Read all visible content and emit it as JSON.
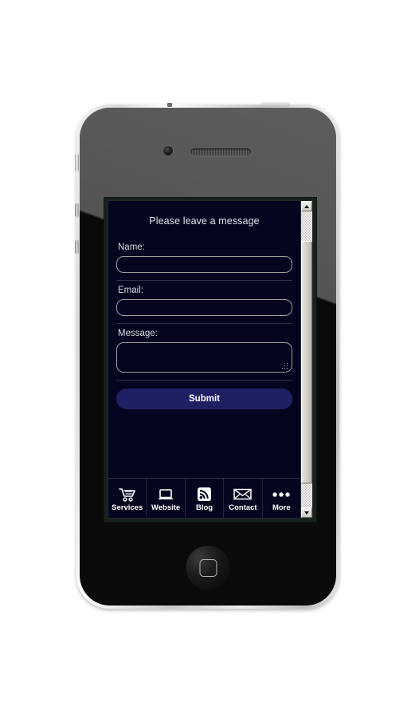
{
  "device": {
    "name": "smartphone-mockup",
    "icons": {
      "front_camera": "camera-icon",
      "earpiece": "speaker-icon",
      "home_button": "home-button-icon",
      "power_button": "power-button",
      "silent_switch": "silent-switch",
      "volume_up": "volume-up-button",
      "volume_down": "volume-down-button"
    }
  },
  "page": {
    "title": "Please leave a message",
    "fields": [
      {
        "key": "name",
        "label": "Name:",
        "value": "",
        "placeholder": "",
        "type": "text"
      },
      {
        "key": "email",
        "label": "Email:",
        "value": "",
        "placeholder": "",
        "type": "text"
      },
      {
        "key": "message",
        "label": "Message:",
        "value": "",
        "placeholder": "",
        "type": "textarea"
      }
    ],
    "submit_label": "Submit",
    "colors": {
      "background": "#05051f",
      "submit_button": "#1f2063",
      "input_border": "#9d9d9a",
      "text": "#e3e3e8",
      "rule": "#2e3046"
    }
  },
  "tabbar": {
    "items": [
      {
        "label": "Services",
        "icon": "shopping-cart-icon"
      },
      {
        "label": "Website",
        "icon": "laptop-icon"
      },
      {
        "label": "Blog",
        "icon": "rss-feed-icon"
      },
      {
        "label": "Contact",
        "icon": "envelope-icon"
      },
      {
        "label": "More",
        "icon": "ellipsis-icon"
      }
    ]
  },
  "scrollbar": {
    "up_arrow": "scroll-up-arrow-icon",
    "down_arrow": "scroll-down-arrow-icon",
    "thumb_top_percent": 10,
    "thumb_height_percent": 82
  }
}
